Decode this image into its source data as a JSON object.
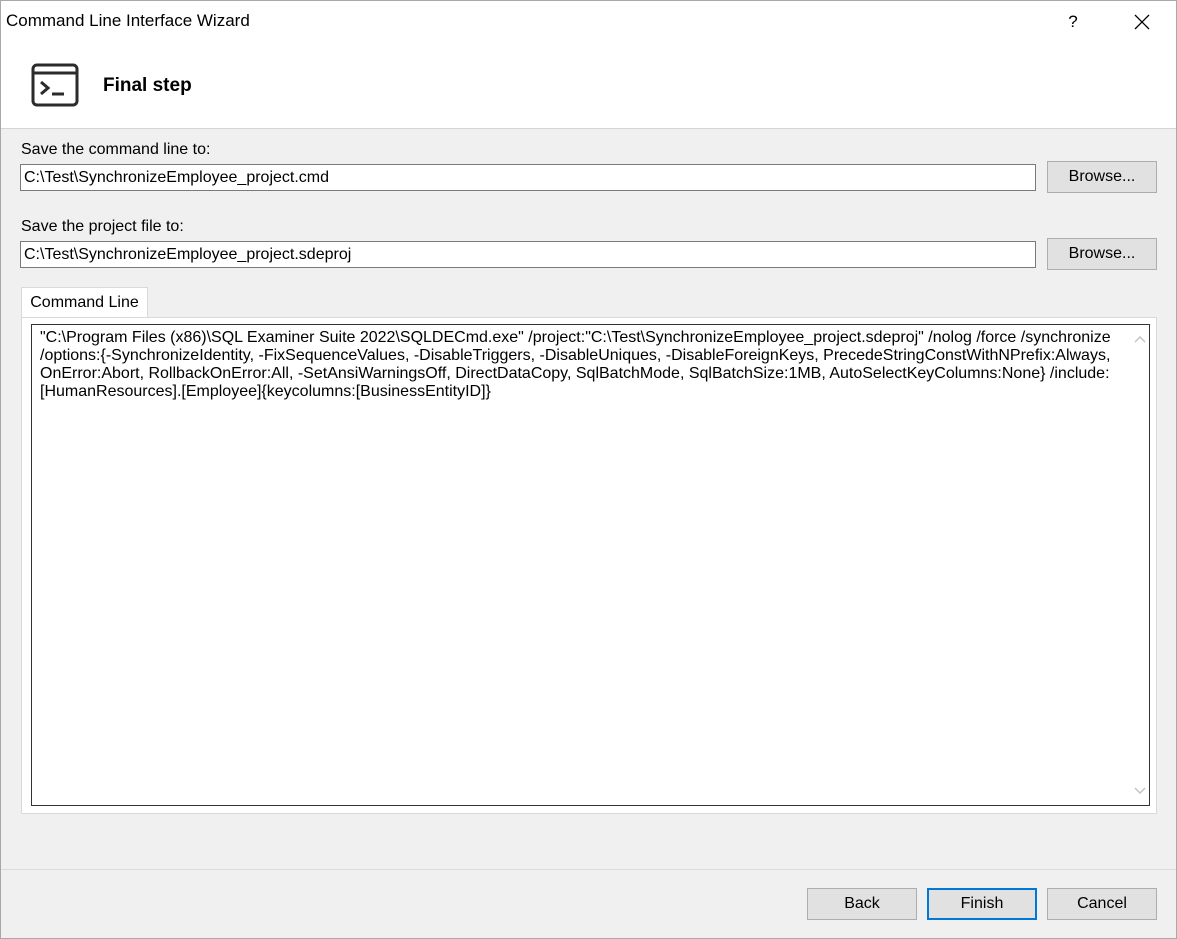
{
  "window": {
    "title": "Command Line Interface Wizard",
    "help_glyph": "?",
    "close_glyph": "✕"
  },
  "header": {
    "step_title": "Final step",
    "icon": "terminal-icon"
  },
  "command_line_file": {
    "label": "Save the command line to:",
    "value": "C:\\Test\\SynchronizeEmployee_project.cmd",
    "browse_label": "Browse..."
  },
  "project_file": {
    "label": "Save the project file to:",
    "value": "C:\\Test\\SynchronizeEmployee_project.sdeproj",
    "browse_label": "Browse..."
  },
  "tabs": [
    {
      "label": "Command Line",
      "active": true
    }
  ],
  "command_text": "\"C:\\Program Files (x86)\\SQL Examiner Suite 2022\\SQLDECmd.exe\"  /project:\"C:\\Test\\SynchronizeEmployee_project.sdeproj\" /nolog /force /synchronize /options:{-SynchronizeIdentity, -FixSequenceValues, -DisableTriggers, -DisableUniques, -DisableForeignKeys, PrecedeStringConstWithNPrefix:Always, OnError:Abort, RollbackOnError:All, -SetAnsiWarningsOff, DirectDataCopy, SqlBatchMode, SqlBatchSize:1MB, AutoSelectKeyColumns:None} /include:[HumanResources].[Employee]{keycolumns:[BusinessEntityID]}",
  "footer": {
    "back_label": "Back",
    "finish_label": "Finish",
    "cancel_label": "Cancel"
  },
  "colors": {
    "accent": "#0078d7",
    "button_bg": "#e1e1e1",
    "dialog_bg": "#f0f0f0"
  }
}
